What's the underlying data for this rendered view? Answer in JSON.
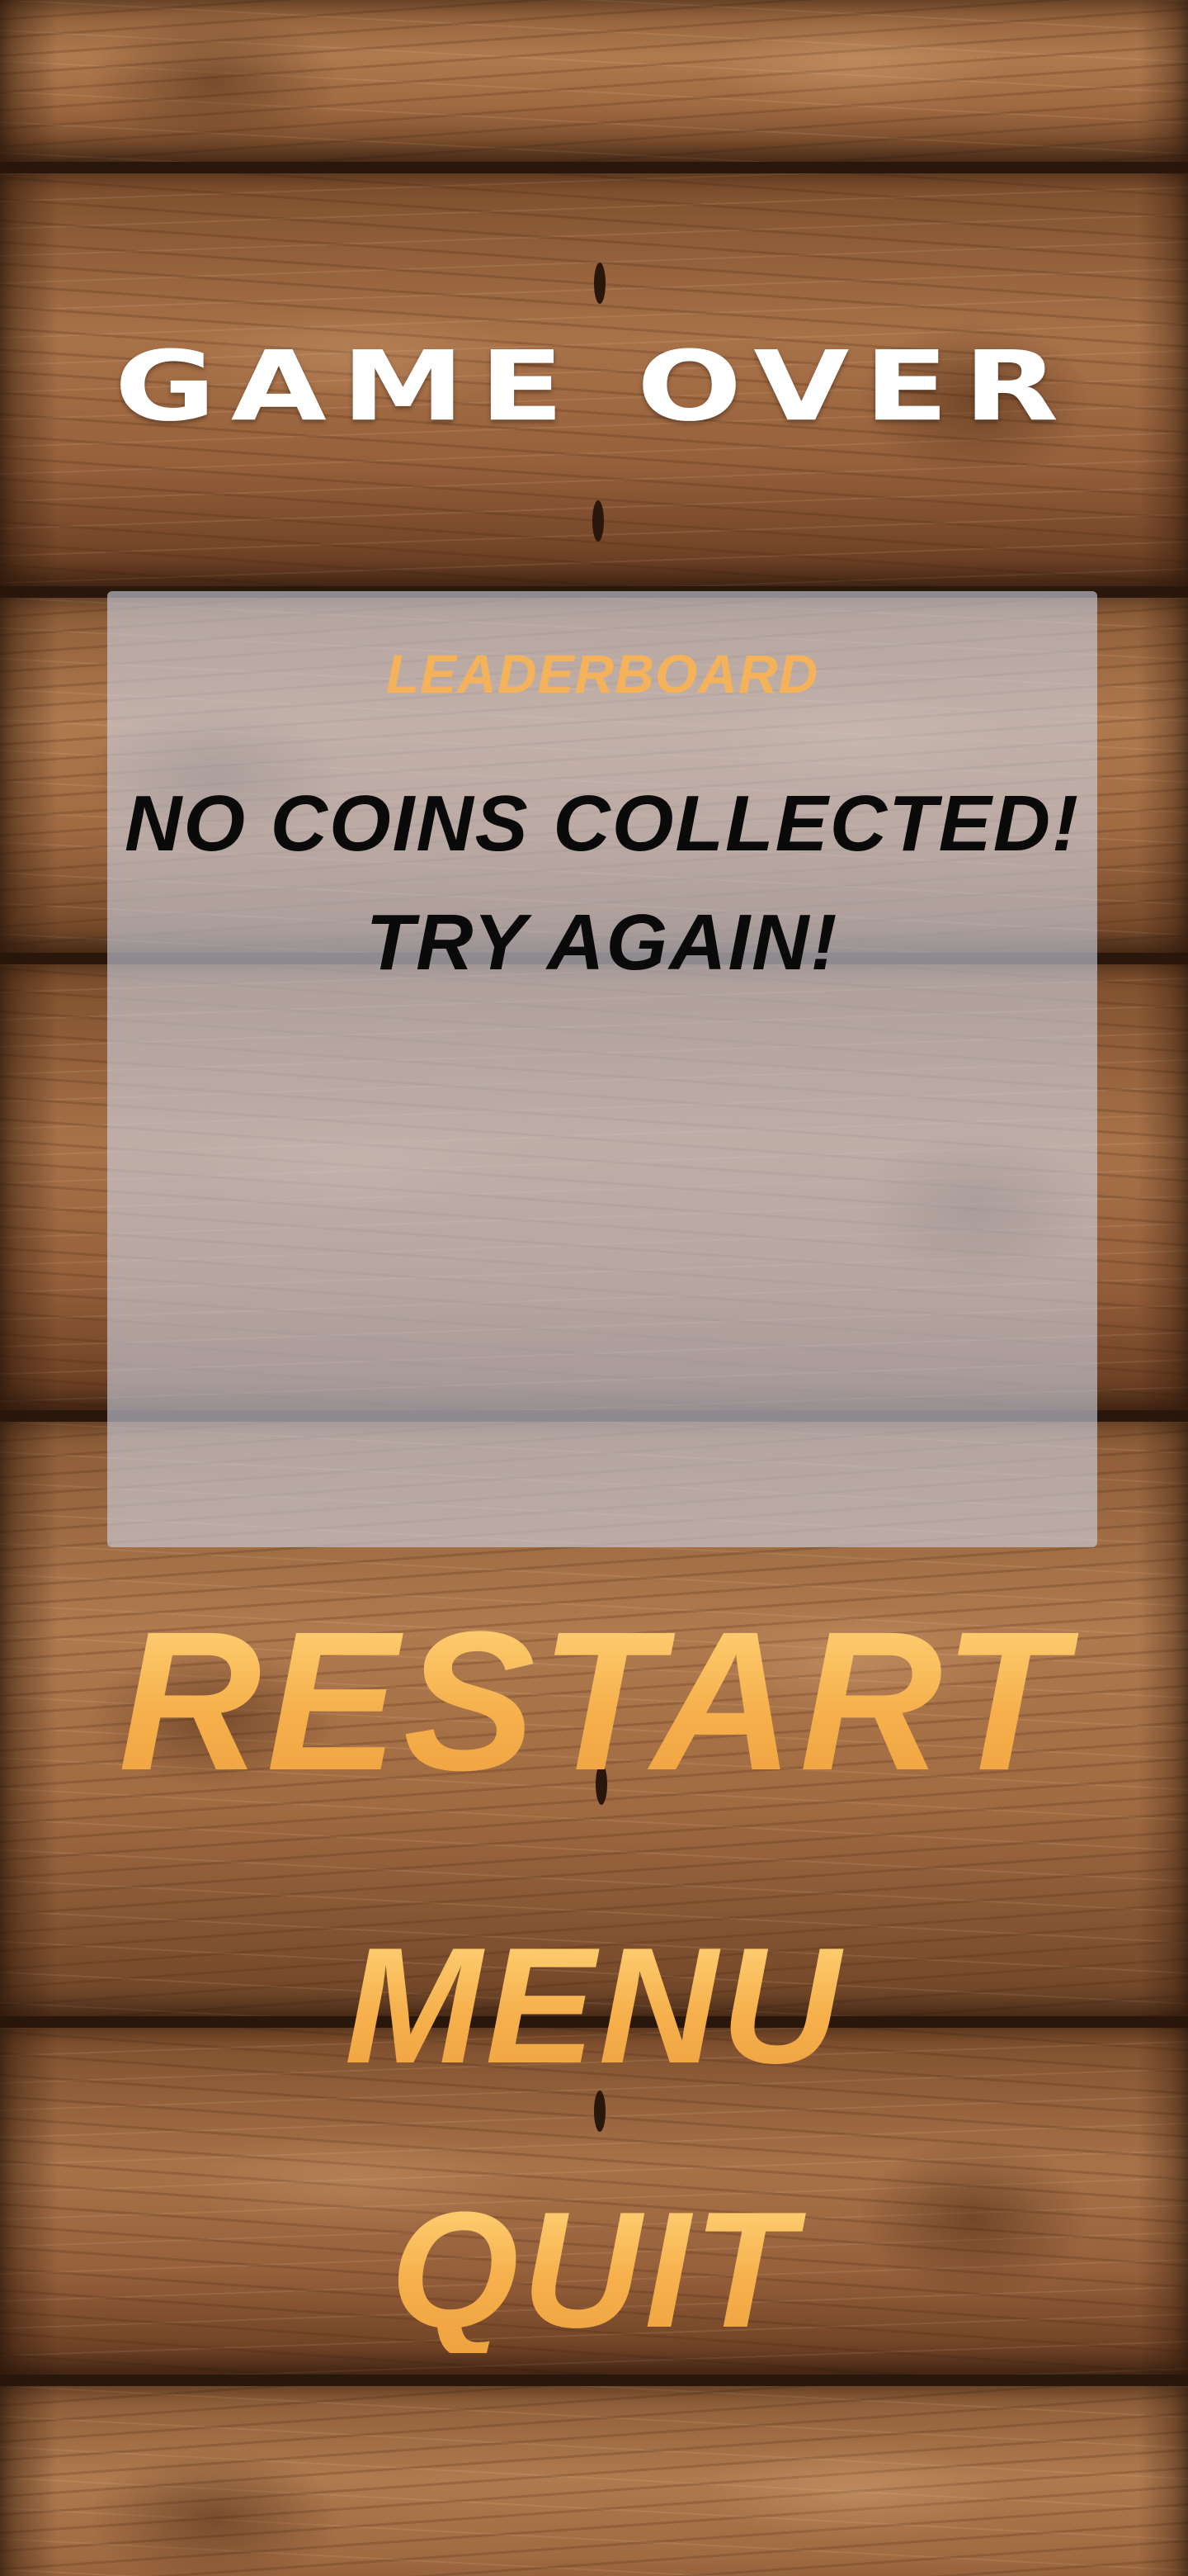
{
  "screen": {
    "title": "GAME OVER"
  },
  "leaderboard": {
    "heading": "LEADERBOARD",
    "message_line_1": "NO COINS COLLECTED!",
    "message_line_2": "TRY AGAIN!"
  },
  "menu": {
    "restart_label": "RESTART",
    "menu_label": "MENU",
    "quit_label": "QUIT"
  },
  "colors": {
    "accent": "#f4b04e",
    "title": "#ffffff",
    "message": "#0a0a0a",
    "panel": "#cdd2e1",
    "wood": "#a06a42"
  }
}
